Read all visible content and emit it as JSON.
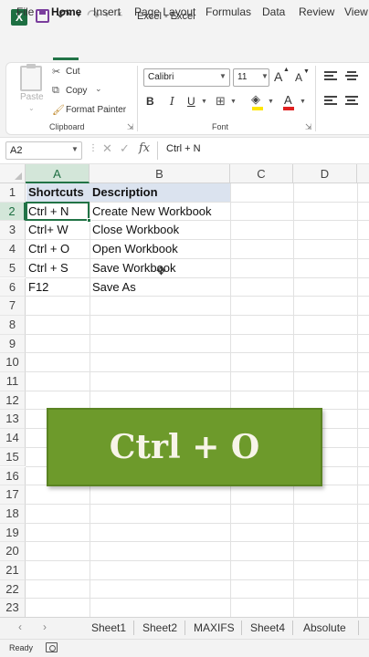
{
  "window": {
    "title": "Excel  -  Excel",
    "app_icon": "X",
    "accent": "#217346"
  },
  "ribbon": {
    "tabs": [
      "File",
      "Home",
      "Insert",
      "Page Layout",
      "Formulas",
      "Data",
      "Review",
      "View"
    ],
    "active_tab": "Home",
    "clipboard": {
      "paste": "Paste",
      "cut": "Cut",
      "copy": "Copy",
      "format_painter": "Format Painter",
      "group_label": "Clipboard"
    },
    "font": {
      "font_name": "Calibri",
      "font_size": "11",
      "group_label": "Font",
      "grow": "A",
      "shrink": "A",
      "bold": "B",
      "italic": "I",
      "underline": "U",
      "font_color_letter": "A",
      "highlight_color": "#ffe600",
      "font_color": "#e02020"
    }
  },
  "formula_bar": {
    "name_box": "A2",
    "fx": "fx",
    "content": "Ctrl + N"
  },
  "sheet": {
    "columns": [
      "A",
      "B",
      "C",
      "D"
    ],
    "selected_column": "A",
    "rows": [
      "1",
      "2",
      "3",
      "4",
      "5",
      "6",
      "7",
      "8",
      "9",
      "10",
      "11",
      "12",
      "13",
      "14",
      "15",
      "16",
      "17",
      "18",
      "19",
      "20",
      "21",
      "22",
      "23"
    ],
    "selected_row": "2",
    "header_fill": "#dbe3ef",
    "cells": {
      "header": [
        "Shortcuts",
        "Description"
      ],
      "data": [
        [
          "Ctrl + N",
          "Create New Workbook"
        ],
        [
          "Ctrl+ W",
          "Close Workbook"
        ],
        [
          "Ctrl + O",
          "Open Workbook"
        ],
        [
          "Ctrl + S",
          "Save Workbook"
        ],
        [
          "F12",
          "Save As"
        ]
      ]
    }
  },
  "overlay": {
    "text": "Ctrl + O",
    "background": "#6d9a2b"
  },
  "sheet_tabs": [
    "Sheet1",
    "Sheet2",
    "MAXIFS",
    "Sheet4",
    "Absolute"
  ],
  "status": {
    "text": "Ready"
  }
}
